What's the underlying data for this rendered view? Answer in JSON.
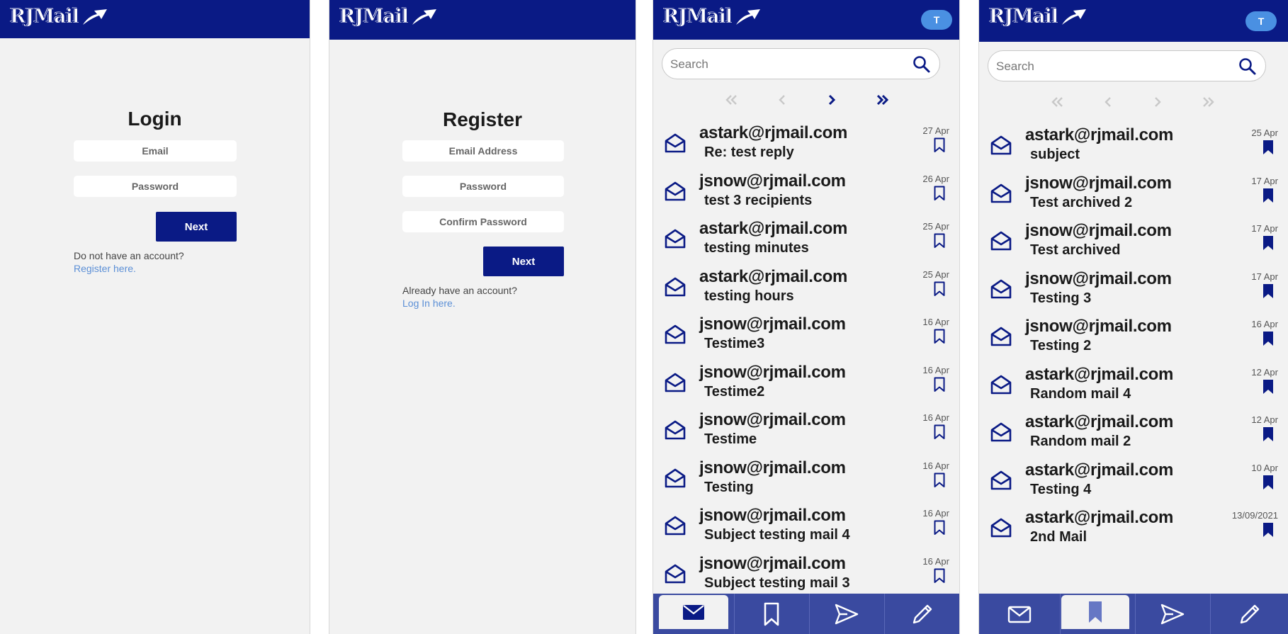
{
  "brand": {
    "name": "RJMail",
    "primary": "#0a1a85",
    "tabbar": "#3a4aa0",
    "avatar": "#4a90e2",
    "link": "#5b8fd6"
  },
  "login": {
    "title": "Login",
    "email_placeholder": "Email",
    "password_placeholder": "Password",
    "next_label": "Next",
    "hint_text": "Do not have an account?",
    "hint_link": "Register here."
  },
  "register": {
    "title": "Register",
    "email_placeholder": "Email Address",
    "password_placeholder": "Password",
    "confirm_placeholder": "Confirm Password",
    "next_label": "Next",
    "hint_text": "Already have an account?",
    "hint_link": "Log In here."
  },
  "inbox": {
    "avatar_initial": "T",
    "search_placeholder": "Search",
    "mails": [
      {
        "sender": "astark@rjmail.com",
        "subject": "Re: test reply",
        "date": "27 Apr"
      },
      {
        "sender": "jsnow@rjmail.com",
        "subject": "test 3 recipients",
        "date": "26 Apr"
      },
      {
        "sender": "astark@rjmail.com",
        "subject": "testing minutes",
        "date": "25 Apr"
      },
      {
        "sender": "astark@rjmail.com",
        "subject": "testing hours",
        "date": "25 Apr"
      },
      {
        "sender": "jsnow@rjmail.com",
        "subject": "Testime3",
        "date": "16 Apr"
      },
      {
        "sender": "jsnow@rjmail.com",
        "subject": "Testime2",
        "date": "16 Apr"
      },
      {
        "sender": "jsnow@rjmail.com",
        "subject": "Testime",
        "date": "16 Apr"
      },
      {
        "sender": "jsnow@rjmail.com",
        "subject": "Testing",
        "date": "16 Apr"
      },
      {
        "sender": "jsnow@rjmail.com",
        "subject": "Subject testing mail 4",
        "date": "16 Apr"
      },
      {
        "sender": "jsnow@rjmail.com",
        "subject": "Subject testing mail 3",
        "date": "16 Apr"
      }
    ]
  },
  "saved": {
    "avatar_initial": "T",
    "search_placeholder": "Search",
    "mails": [
      {
        "sender": "astark@rjmail.com",
        "subject": "subject",
        "date": "25 Apr"
      },
      {
        "sender": "jsnow@rjmail.com",
        "subject": "Test archived 2",
        "date": "17 Apr"
      },
      {
        "sender": "jsnow@rjmail.com",
        "subject": "Test archived",
        "date": "17 Apr"
      },
      {
        "sender": "jsnow@rjmail.com",
        "subject": "Testing 3",
        "date": "17 Apr"
      },
      {
        "sender": "jsnow@rjmail.com",
        "subject": "Testing 2",
        "date": "16 Apr"
      },
      {
        "sender": "astark@rjmail.com",
        "subject": "Random mail 4",
        "date": "12 Apr"
      },
      {
        "sender": "astark@rjmail.com",
        "subject": "Random mail 2",
        "date": "12 Apr"
      },
      {
        "sender": "astark@rjmail.com",
        "subject": "Testing 4",
        "date": "10 Apr"
      },
      {
        "sender": "astark@rjmail.com",
        "subject": "2nd Mail",
        "date": "13/09/2021"
      }
    ]
  },
  "icons": [
    "paper-plane-icon",
    "search-icon",
    "first-page-icon",
    "prev-page-icon",
    "next-page-icon",
    "last-page-icon",
    "open-envelope-icon",
    "bookmark-outline-icon",
    "bookmark-filled-icon",
    "envelope-icon",
    "send-icon",
    "pencil-icon"
  ]
}
